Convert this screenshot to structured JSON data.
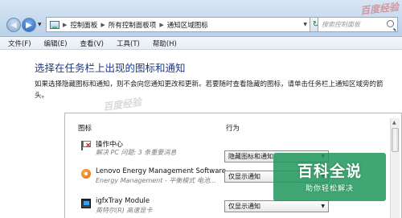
{
  "address": {
    "crumbs": [
      "控制面板",
      "所有控制面板项",
      "通知区域图标"
    ]
  },
  "search": {
    "placeholder": "搜索控制面板"
  },
  "menu": [
    "文件(F)",
    "编辑(E)",
    "查看(V)",
    "工具(T)",
    "帮助(H)"
  ],
  "page": {
    "heading": "选择在任务栏上出现的图标和通知",
    "description": "如果选择隐藏图标和通知，则不会向您通知更改和更新。若要随时查看隐藏的图标，请单击任务栏上通知区域旁的箭头。"
  },
  "table": {
    "col_icon": "图标",
    "col_behavior": "行为",
    "rows": [
      {
        "title": "操作中心",
        "subtitle": "解决 PC 问题: 3 条重要消息",
        "behavior": "隐藏图标和通知",
        "icon": "action-center-flag-icon"
      },
      {
        "title": "Lenovo Energy Management Software",
        "subtitle": "Energy Management - 平衡模式 电池...",
        "behavior": "仅显示通知",
        "icon": "lenovo-energy-icon"
      },
      {
        "title": "igfxTray Module",
        "subtitle": "英特尔(R) 高速显卡",
        "behavior": "仅显示通知",
        "icon": "intel-graphics-icon"
      }
    ]
  },
  "watermarks": {
    "top": "百度经验",
    "mid": "百度经验",
    "brand_title": "百科全说",
    "brand_sub": "助你轻松解决"
  },
  "colors": {
    "heading": "#1e3a8a",
    "brand": "#1e965a"
  }
}
